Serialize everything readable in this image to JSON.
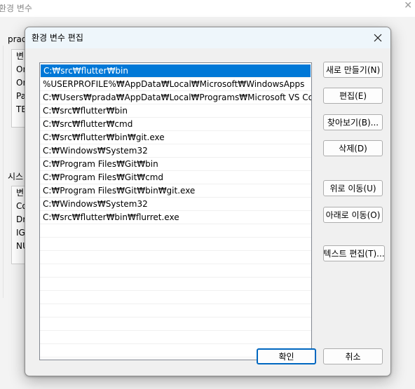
{
  "background_window": {
    "title": "환경 변수",
    "user_section_label": "prad",
    "user_var_rows": [
      "변",
      "On",
      "On",
      "Pa",
      "TE"
    ],
    "system_section_label": "시스",
    "system_var_rows": [
      "변",
      "Co",
      "Dr",
      "IG",
      "NU"
    ]
  },
  "dialog": {
    "title": "환경 변수 편집",
    "paths": [
      "C:₩src₩flutter₩bin",
      "%USERPROFILE%₩AppData₩Local₩Microsoft₩WindowsApps",
      "C:₩Users₩prada₩AppData₩Local₩Programs₩Microsoft VS Code₩bin",
      "C:₩src₩flutter₩bin",
      "C:₩src₩flutter₩cmd",
      "C:₩src₩flutter₩bin₩git.exe",
      "C:₩Windows₩System32",
      "C:₩Program Files₩Git₩bin",
      "C:₩Program Files₩Git₩cmd",
      "C:₩Program Files₩Git₩bin₩git.exe",
      "C:₩Windows₩System32",
      "C:₩src₩flutter₩bin₩flurret.exe"
    ],
    "selected_index": 0,
    "buttons": {
      "new": "새로 만들기(N)",
      "edit": "편집(E)",
      "browse": "찾아보기(B)...",
      "delete": "삭제(D)",
      "move_up": "위로 이동(U)",
      "move_down": "아래로 이동(O)",
      "edit_text": "텍스트 편집(T)...",
      "ok": "확인",
      "cancel": "취소"
    },
    "colors": {
      "selection": "#0078d7",
      "default_button_border": "#0067c0"
    }
  }
}
